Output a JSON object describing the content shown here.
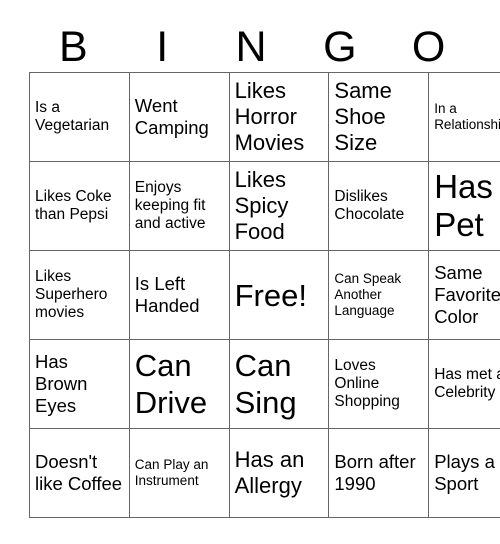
{
  "card": {
    "header_letters": [
      "B",
      "I",
      "N",
      "G",
      "O"
    ],
    "rows": [
      [
        {
          "text": "Is a Vegetarian",
          "size": "fs-15"
        },
        {
          "text": "Went Camping",
          "size": "fs-18"
        },
        {
          "text": "Likes Horror Movies",
          "size": "fs-22"
        },
        {
          "text": "Same Shoe Size",
          "size": "fs-22"
        },
        {
          "text": "In a Relationship",
          "size": "fs-13"
        }
      ],
      [
        {
          "text": "Likes Coke than Pepsi",
          "size": "fs-15"
        },
        {
          "text": "Enjoys keeping fit and active",
          "size": "fs-15"
        },
        {
          "text": "Likes Spicy Food",
          "size": "fs-22"
        },
        {
          "text": "Dislikes Chocolate",
          "size": "fs-15"
        },
        {
          "text": "Has a Pet",
          "size": "fs-33"
        }
      ],
      [
        {
          "text": "Likes Superhero movies",
          "size": "fs-15"
        },
        {
          "text": "Is Left Handed",
          "size": "fs-18"
        },
        {
          "text": "Free!",
          "size": "fs-31"
        },
        {
          "text": "Can Speak Another Language",
          "size": "fs-13"
        },
        {
          "text": "Same Favorite Color",
          "size": "fs-18"
        }
      ],
      [
        {
          "text": "Has Brown Eyes",
          "size": "fs-18"
        },
        {
          "text": "Can Drive",
          "size": "fs-31"
        },
        {
          "text": "Can Sing",
          "size": "fs-31"
        },
        {
          "text": "Loves Online Shopping",
          "size": "fs-15"
        },
        {
          "text": "Has met a Celebrity",
          "size": "fs-15"
        }
      ],
      [
        {
          "text": "Doesn't like Coffee",
          "size": "fs-18"
        },
        {
          "text": "Can Play an Instrument",
          "size": "fs-13"
        },
        {
          "text": "Has an Allergy",
          "size": "fs-22"
        },
        {
          "text": "Born after 1990",
          "size": "fs-18"
        },
        {
          "text": "Plays a Sport",
          "size": "fs-18"
        }
      ]
    ]
  },
  "colors": {
    "background": "#ffffff",
    "text": "#000000",
    "grid_line": "#666666"
  }
}
